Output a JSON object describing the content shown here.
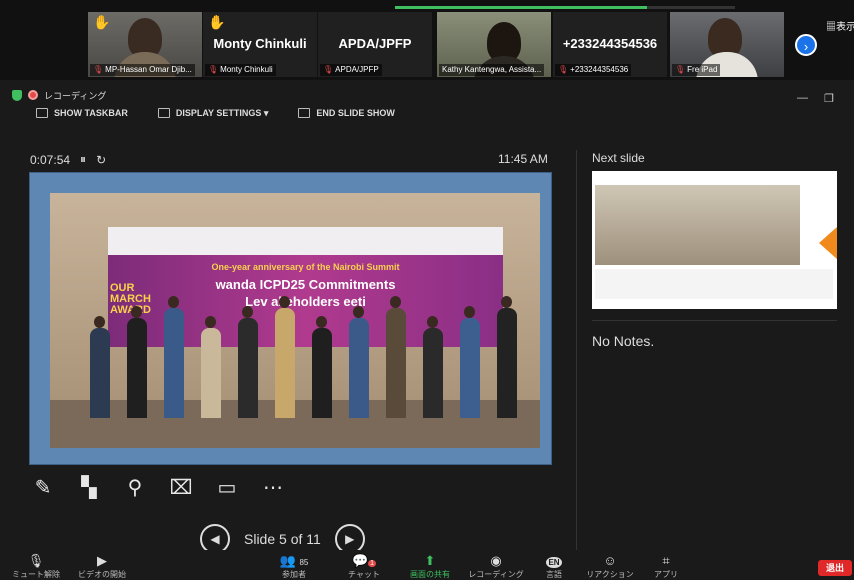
{
  "participants": [
    {
      "kind": "video",
      "name": "MP-Hassan Omar Djib...",
      "raised_hand": true
    },
    {
      "kind": "text",
      "display": "Monty Chinkuli",
      "name": "Monty Chinkuli",
      "raised_hand": true
    },
    {
      "kind": "text",
      "display": "APDA/JPFP",
      "name": "APDA/JPFP",
      "raised_hand": false
    },
    {
      "kind": "video",
      "name": "Kathy Kantengwa, Assista...",
      "raised_hand": false
    },
    {
      "kind": "text",
      "display": "+233244354536",
      "name": "+233244354536",
      "raised_hand": false
    },
    {
      "kind": "video",
      "name": "Fre iPad",
      "raised_hand": false
    }
  ],
  "strip_progress": 0.74,
  "view_label": "表示",
  "recording": {
    "label": "レコーディング"
  },
  "toolbar": {
    "show_taskbar": "SHOW TASKBAR",
    "display_settings": "DISPLAY SETTINGS ▾",
    "end_slide_show": "END SLIDE SHOW"
  },
  "presenter": {
    "elapsed": "0:07:54",
    "clock": "11:45 AM",
    "slide_text": {
      "line1": "One-year anniversary of the Nairobi Summit",
      "line2": "wanda ICPD25 Commitments",
      "line3": "Lev    akeholders    eeti",
      "march": "OUR MARCH AWARD"
    },
    "slide_counter": "Slide 5 of 11"
  },
  "next_slide": {
    "label": "Next slide"
  },
  "notes": "No Notes.",
  "bottom_bar": {
    "mute": "ミュート解除",
    "video": "ビデオの開始",
    "participants": "参加者",
    "participants_count": "85",
    "chat": "チャット",
    "chat_badge": "1",
    "share": "画面の共有",
    "record": "レコーディング",
    "language": "言語",
    "language_code": "EN",
    "reactions": "リアクション",
    "apps": "アプリ",
    "leave": "退出"
  },
  "colors": {
    "accent": "#1a73e8",
    "leave": "#e02828",
    "share": "#3fbf5f",
    "banner": "#b03a8e"
  }
}
